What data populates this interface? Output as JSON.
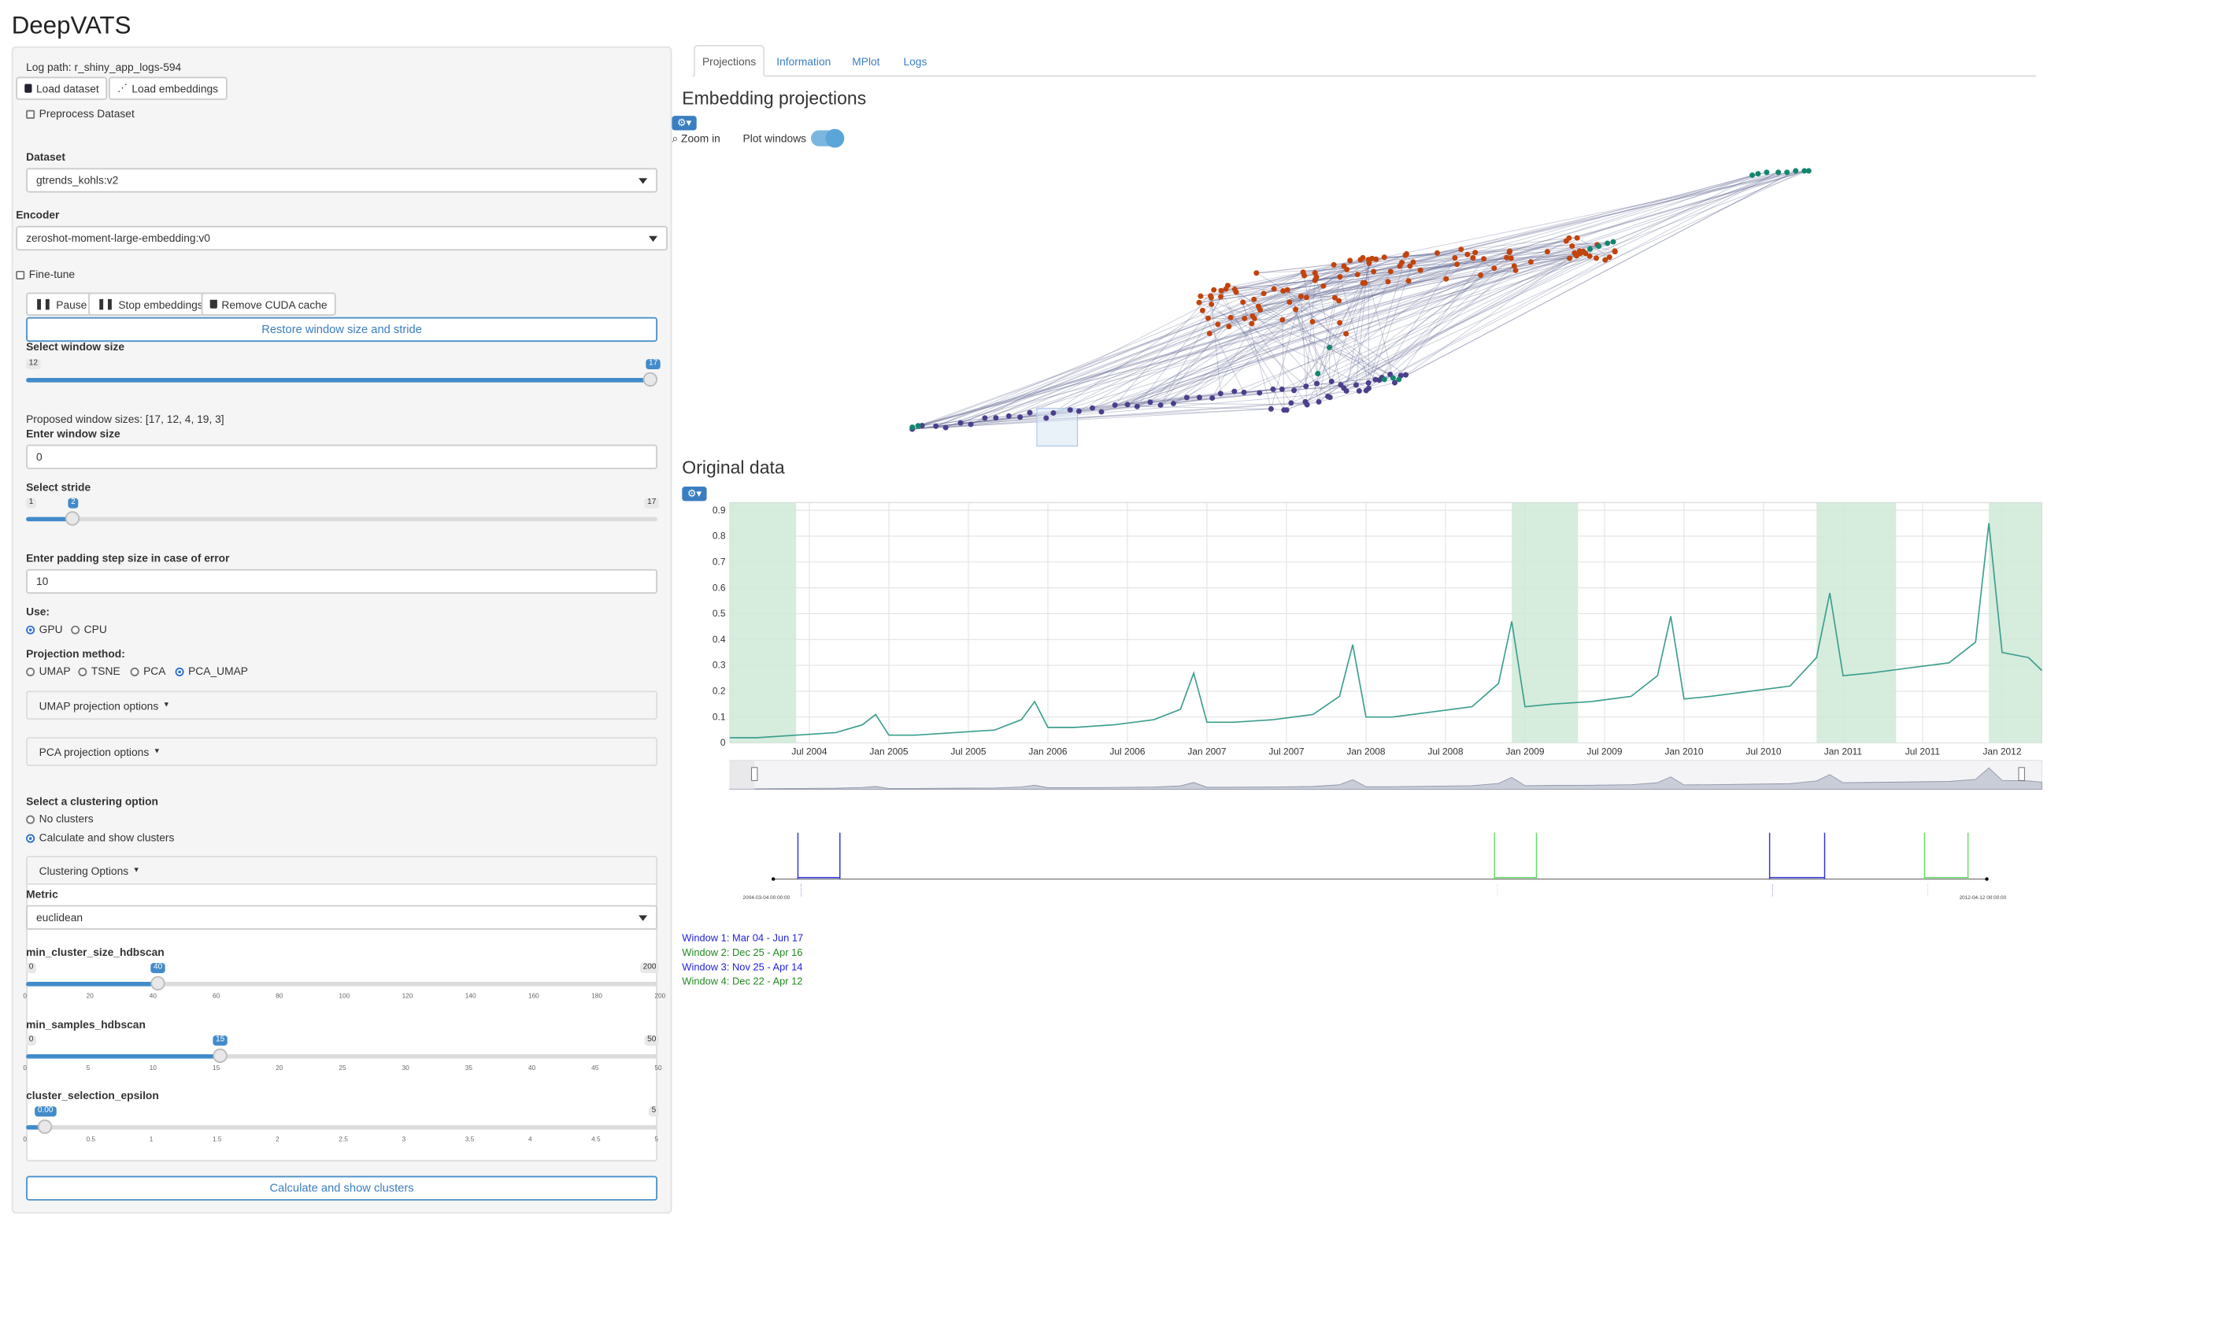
{
  "app": {
    "title": "DeepVATS"
  },
  "sidebar": {
    "log_path": "Log path: r_shiny_app_logs-594",
    "load_dataset": "Load dataset",
    "load_embeddings": "Load embeddings",
    "preprocess_label": "Preprocess Dataset",
    "dataset_label": "Dataset",
    "dataset_value": "gtrends_kohls:v2",
    "encoder_label": "Encoder",
    "encoder_value": "zeroshot-moment-large-embedding:v0",
    "finetune_label": "Fine-tune",
    "pause_label": "Pause",
    "stop_embeddings_label": "Stop embeddings",
    "remove_cuda_label": "Remove CUDA cache",
    "restore_label": "Restore window size and stride",
    "window_size_slider": {
      "label": "Select window size",
      "min": "12",
      "max": "17",
      "value": 17,
      "value_label": "17"
    },
    "proposed_sizes": "Proposed window sizes: [17, 12, 4, 19, 3]",
    "enter_window_label": "Enter window size",
    "enter_window_value": "0",
    "stride_slider": {
      "label": "Select stride",
      "min": "1",
      "max": "17",
      "value": 2,
      "value_label": "2"
    },
    "padding_label": "Enter padding step size in case of error",
    "padding_value": "10",
    "use_label": "Use:",
    "use_options": [
      "GPU",
      "CPU"
    ],
    "use_selected": "GPU",
    "projection_label": "Projection method:",
    "projection_options": [
      "UMAP",
      "TSNE",
      "PCA",
      "PCA_UMAP"
    ],
    "projection_selected": "PCA_UMAP",
    "umap_options_label": "UMAP projection options",
    "pca_options_label": "PCA projection options",
    "clustering_label": "Select a clustering option",
    "clustering_options": [
      "No clusters",
      "Calculate and show clusters"
    ],
    "clustering_selected": "Calculate and show clusters",
    "clustering_panel_label": "Clustering Options",
    "metric_label": "Metric",
    "metric_value": "euclidean",
    "min_cluster": {
      "label": "min_cluster_size_hdbscan",
      "min": "0",
      "max": "200",
      "value": 40,
      "value_label": "40",
      "ticks": [
        "0",
        "20",
        "40",
        "60",
        "80",
        "100",
        "120",
        "140",
        "160",
        "180",
        "200"
      ]
    },
    "min_samples": {
      "label": "min_samples_hdbscan",
      "min": "0",
      "max": "50",
      "value": 15,
      "value_label": "15",
      "ticks": [
        "0",
        "5",
        "10",
        "15",
        "20",
        "25",
        "30",
        "35",
        "40",
        "45",
        "50"
      ]
    },
    "epsilon": {
      "label": "cluster_selection_epsilon",
      "min": "0",
      "max": "5",
      "value": 0,
      "value_label": "0.00",
      "ticks": [
        "0",
        "0.5",
        "1",
        "1.5",
        "2",
        "2.5",
        "3",
        "3.5",
        "4",
        "4.5",
        "5"
      ]
    },
    "calc_button": "Calculate and show clusters"
  },
  "tabs": [
    "Projections",
    "Information",
    "MPlot",
    "Logs"
  ],
  "active_tab": "Projections",
  "projections": {
    "title": "Embedding projections",
    "zoom_label": "Zoom in",
    "plot_windows_label": "Plot windows",
    "plot_windows_on": true
  },
  "original": {
    "title": "Original data",
    "window_lines": [
      {
        "text": "Window 1: Mar 04 - Jun 17",
        "color": "#2222dd"
      },
      {
        "text": "Window 2: Dec 25 - Apr 16",
        "color": "#228822"
      },
      {
        "text": "Window 3: Nov 25 - Apr 14",
        "color": "#2222dd"
      },
      {
        "text": "Window 4: Dec 22 - Apr 12",
        "color": "#228822"
      }
    ],
    "timeline_start_label": "2004-03-04 00:00:00",
    "timeline_end_label": "2012-04-12 00:00:00"
  },
  "colors": {
    "accent": "#428bca",
    "cluster_orange": "#c1440e",
    "cluster_purple": "#4b3f8c",
    "cluster_teal": "#12866e",
    "line": "#3b9e8e",
    "window_fill": "#cfe9d7"
  },
  "chart_data": {
    "type": "line",
    "title": "",
    "xlabel": "",
    "ylabel": "",
    "x_range": [
      "2004-01",
      "2012-04"
    ],
    "ylim": [
      0,
      0.93
    ],
    "yticks": [
      "0",
      "0.1",
      "0.2",
      "0.3",
      "0.4",
      "0.5",
      "0.6",
      "0.7",
      "0.8",
      "0.9"
    ],
    "xticks": [
      "Jul 2004",
      "Jan 2005",
      "Jul 2005",
      "Jan 2006",
      "Jul 2006",
      "Jan 2007",
      "Jul 2007",
      "Jan 2008",
      "Jul 2008",
      "Jan 2009",
      "Jul 2009",
      "Jan 2010",
      "Jul 2010",
      "Jan 2011",
      "Jul 2011",
      "Jan 2012"
    ],
    "series": [
      {
        "x": [
          "2004-01",
          "2004-03",
          "2004-06",
          "2004-09",
          "2004-11",
          "2004-12",
          "2005-01",
          "2005-03",
          "2005-06",
          "2005-09",
          "2005-11",
          "2005-12",
          "2006-01",
          "2006-03",
          "2006-06",
          "2006-09",
          "2006-11",
          "2006-12",
          "2007-01",
          "2007-03",
          "2007-06",
          "2007-09",
          "2007-11",
          "2007-12",
          "2008-01",
          "2008-03",
          "2008-06",
          "2008-09",
          "2008-11",
          "2008-12",
          "2009-01",
          "2009-03",
          "2009-06",
          "2009-09",
          "2009-11",
          "2009-12",
          "2010-01",
          "2010-03",
          "2010-06",
          "2010-09",
          "2010-11",
          "2010-12",
          "2011-01",
          "2011-03",
          "2011-06",
          "2011-09",
          "2011-11",
          "2011-12",
          "2012-01",
          "2012-03",
          "2012-04"
        ],
        "values": [
          0.02,
          0.02,
          0.03,
          0.04,
          0.07,
          0.11,
          0.03,
          0.03,
          0.04,
          0.05,
          0.09,
          0.16,
          0.06,
          0.06,
          0.07,
          0.09,
          0.13,
          0.27,
          0.08,
          0.08,
          0.09,
          0.11,
          0.18,
          0.38,
          0.1,
          0.1,
          0.12,
          0.14,
          0.23,
          0.47,
          0.14,
          0.15,
          0.16,
          0.18,
          0.26,
          0.49,
          0.17,
          0.18,
          0.2,
          0.22,
          0.33,
          0.58,
          0.26,
          0.27,
          0.29,
          0.31,
          0.39,
          0.85,
          0.35,
          0.33,
          0.28
        ]
      }
    ],
    "highlight_windows": [
      {
        "start": "2004-01",
        "end": "2004-06"
      },
      {
        "start": "2008-12",
        "end": "2009-05"
      },
      {
        "start": "2010-11",
        "end": "2011-05"
      },
      {
        "start": "2011-12",
        "end": "2012-04"
      }
    ]
  }
}
